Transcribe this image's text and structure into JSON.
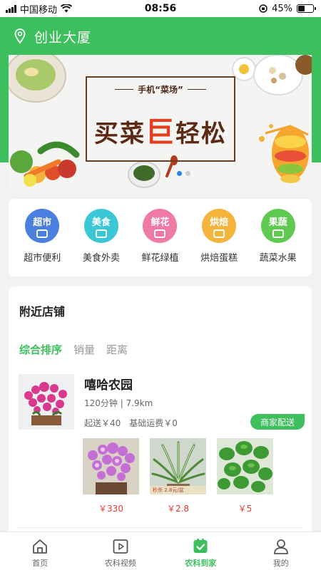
{
  "status_bar": {
    "carrier": "中国移动",
    "time": "08:56",
    "battery": "45%",
    "battery_level": 0.45
  },
  "location": {
    "name": "创业大厦"
  },
  "banner": {
    "small_text": "手机“菜场”",
    "big_pre": "买菜",
    "big_hl": "巨",
    "big_post": "轻松"
  },
  "categories": [
    {
      "icon_text": "超市",
      "label": "超市便利",
      "color": "#4a7fe0"
    },
    {
      "icon_text": "美食",
      "label": "美食外卖",
      "color": "#3cc7d6"
    },
    {
      "icon_text": "鲜花",
      "label": "鲜花绿植",
      "color": "#f07aa6"
    },
    {
      "icon_text": "烘焙",
      "label": "烘焙蛋糕",
      "color": "#f5b53c"
    },
    {
      "icon_text": "果蔬",
      "label": "蔬菜水果",
      "color": "#5ecb50"
    }
  ],
  "nearby": {
    "title": "附近店铺",
    "sorts": [
      "综合排序",
      "销量",
      "距离"
    ],
    "store": {
      "name": "嘻哈农园",
      "meta": "120分钟 | 7.9km",
      "min_order": "起送￥40",
      "delivery_fee": "基础运费￥0",
      "badge": "商家配送",
      "products": [
        {
          "price": "￥330"
        },
        {
          "price": "￥2.8",
          "tag": "秒杀  2.8元/盆"
        },
        {
          "price": "￥5"
        }
      ]
    }
  },
  "tabs": [
    {
      "label": "首页"
    },
    {
      "label": "农科视频"
    },
    {
      "label": "农科到家"
    },
    {
      "label": "我的"
    }
  ]
}
